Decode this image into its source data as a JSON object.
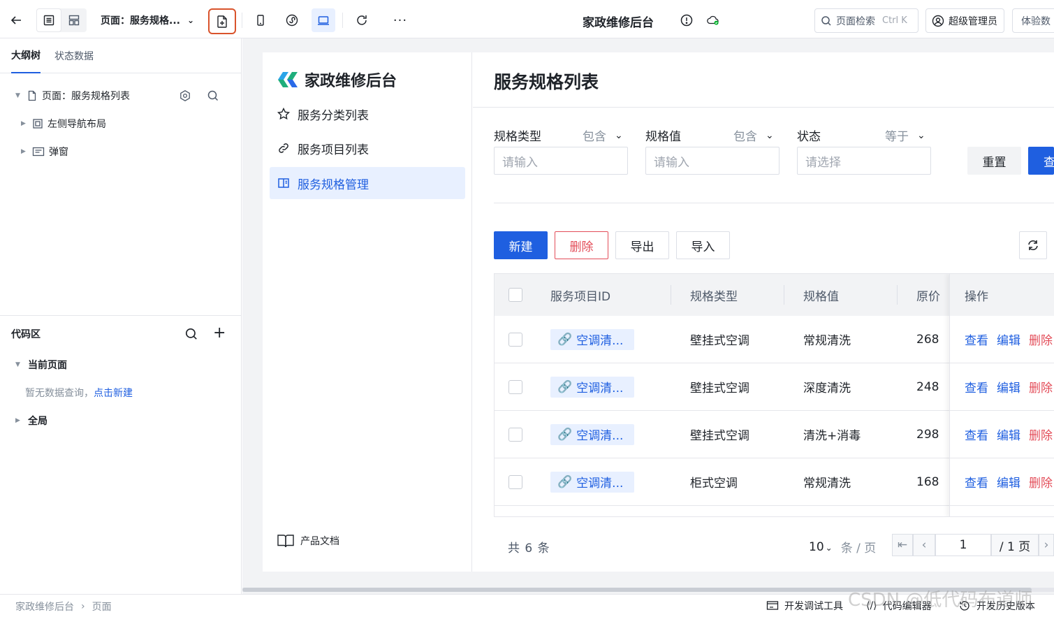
{
  "topbar": {
    "page_selector": "页面：服务规格...",
    "app_title": "家政维修后台",
    "search_label": "页面检索",
    "search_shortcut": "Ctrl K",
    "admin_label": "超级管理员",
    "trial_label": "体验数"
  },
  "left_panel": {
    "tabs": [
      "大纲树",
      "状态数据"
    ],
    "tree": {
      "root": "页面：服务规格列表",
      "children": [
        "左侧导航布局",
        "弹窗"
      ]
    },
    "code_area": {
      "title": "代码区",
      "current_page": "当前页面",
      "empty_text": "暂无数据查询，",
      "create_link": "点击新建",
      "global": "全局"
    }
  },
  "app": {
    "brand": "家政维修后台",
    "nav": [
      "服务分类列表",
      "服务项目列表",
      "服务规格管理"
    ],
    "docs": "产品文档"
  },
  "page": {
    "title": "服务规格列表",
    "filters": [
      {
        "label": "规格类型",
        "op": "包含",
        "placeholder": "请输入"
      },
      {
        "label": "规格值",
        "op": "包含",
        "placeholder": "请输入"
      },
      {
        "label": "状态",
        "op": "等于",
        "placeholder": "请选择"
      }
    ],
    "reset_label": "重置",
    "query_label": "查",
    "actions": {
      "new": "新建",
      "delete": "删除",
      "export": "导出",
      "import": "导入"
    },
    "table": {
      "columns": [
        "服务项目ID",
        "规格类型",
        "规格值",
        "原价",
        "操作"
      ],
      "rows": [
        {
          "service": "空调清...",
          "type": "壁挂式空调",
          "value": "常规清洗",
          "price": "268"
        },
        {
          "service": "空调清...",
          "type": "壁挂式空调",
          "value": "深度清洗",
          "price": "248"
        },
        {
          "service": "空调清...",
          "type": "壁挂式空调",
          "value": "清洗+消毒",
          "price": "298"
        },
        {
          "service": "空调清...",
          "type": "柜式空调",
          "value": "常规清洗",
          "price": "168"
        }
      ],
      "row_actions": [
        "查看",
        "编辑",
        "删除"
      ]
    },
    "pagination": {
      "total_text": "共 6 条",
      "page_size": "10",
      "page_size_unit": "条 / 页",
      "current_page": "1",
      "total_pages": "/ 1 页"
    }
  },
  "statusbar": {
    "breadcrumb": [
      "家政维修后台",
      "页面"
    ],
    "tools": [
      "开发调试工具",
      "代码编辑器",
      "开发历史版本"
    ]
  },
  "watermark": "CSDN @低代码布道师",
  "colors": {
    "primary": "#1f5fe0",
    "danger": "#e34d59",
    "highlight_border": "#d9532c"
  }
}
